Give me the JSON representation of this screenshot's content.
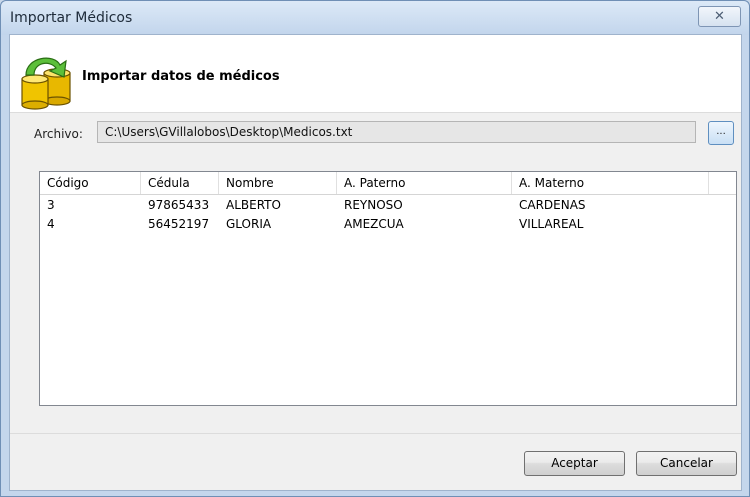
{
  "window": {
    "title": "Importar Médicos",
    "close_icon": "✕"
  },
  "header": {
    "title": "Importar datos de médicos",
    "icon": "database-import-icon"
  },
  "archivo": {
    "label": "Archivo:",
    "value": "C:\\Users\\GVillalobos\\Desktop\\Medicos.txt",
    "browse_label": "..."
  },
  "table": {
    "columns": [
      "Código",
      "Cédula",
      "Nombre",
      "A. Paterno",
      "A. Materno"
    ],
    "rows": [
      [
        "3",
        "97865433",
        "ALBERTO",
        "REYNOSO",
        "CARDENAS"
      ],
      [
        "4",
        "56452197",
        "GLORIA",
        "AMEZCUA",
        "VILLAREAL"
      ]
    ]
  },
  "buttons": {
    "accept": "Aceptar",
    "cancel": "Cancelar"
  }
}
